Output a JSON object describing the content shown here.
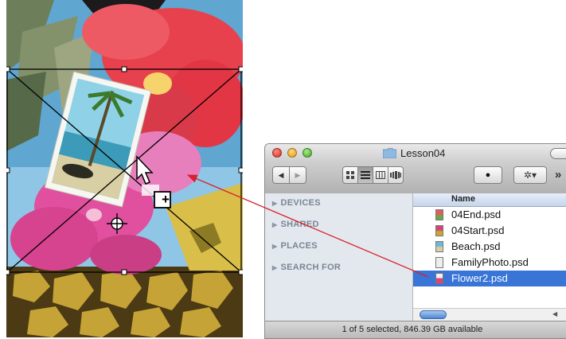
{
  "window": {
    "title": "Lesson04",
    "overflow_glyph": "»"
  },
  "toolbar": {
    "back_glyph": "◀",
    "forward_glyph": "▶",
    "eye_glyph": "●",
    "gear_glyph": "✲▾"
  },
  "sidebar": {
    "sections": [
      {
        "label": "DEVICES"
      },
      {
        "label": "SHARED"
      },
      {
        "label": "PLACES"
      },
      {
        "label": "SEARCH FOR"
      }
    ]
  },
  "file_list": {
    "column_header": "Name",
    "files": [
      {
        "name": "04End.psd",
        "selected": false
      },
      {
        "name": "04Start.psd",
        "selected": false
      },
      {
        "name": "Beach.psd",
        "selected": false
      },
      {
        "name": "FamilyPhoto.psd",
        "selected": false
      },
      {
        "name": "Flower2.psd",
        "selected": true
      }
    ]
  },
  "status": {
    "text": "1 of 5 selected, 846.39 GB available"
  },
  "canvas": {
    "place_cursor_glyph": "+"
  },
  "colors": {
    "selection": "#3875d7",
    "drag_arrow": "#d8202a",
    "sidebar_bg": "#e3e8ee"
  }
}
